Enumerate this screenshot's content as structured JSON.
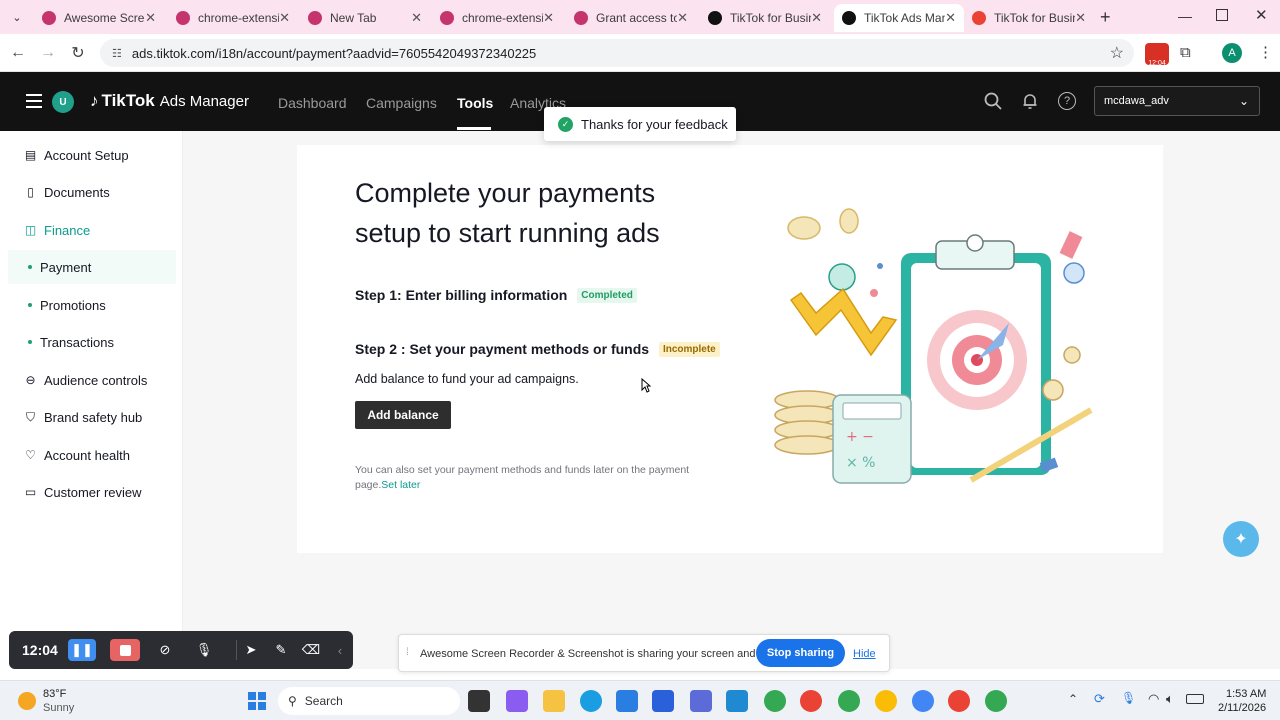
{
  "browser": {
    "tabs": [
      {
        "title": "Awesome Screen",
        "icon": "chrome-icon",
        "active": false
      },
      {
        "title": "chrome-extensio",
        "icon": "chrome-icon",
        "active": false
      },
      {
        "title": "New Tab",
        "icon": "chrome-icon",
        "active": false
      },
      {
        "title": "chrome-extensio",
        "icon": "chrome-icon",
        "active": false
      },
      {
        "title": "Grant access to f",
        "icon": "chrome-icon",
        "active": false
      },
      {
        "title": "TikTok for Busine",
        "icon": "tiktok-icon",
        "active": false
      },
      {
        "title": "TikTok Ads Mana",
        "icon": "tiktok-icon",
        "active": true
      },
      {
        "title": "TikTok for Busine",
        "icon": "gmail-icon",
        "active": false
      }
    ],
    "new_tab": "+",
    "url": "ads.tiktok.com/i18n/account/payment?aadvid=7605542049372340225",
    "ext_badge": "12:04",
    "profile_initial": "A"
  },
  "header": {
    "avatar_initial": "U",
    "brand": "TikTok",
    "brand_suffix": "Ads Manager",
    "nav": [
      "Dashboard",
      "Campaigns",
      "Tools",
      "Analytics"
    ],
    "active_nav": "Tools",
    "account": "mcdawa_adv"
  },
  "toast": {
    "text": "Thanks for your feedback"
  },
  "sidebar": {
    "items": [
      {
        "label": "Account Setup",
        "icon": "id-card-icon",
        "type": "top"
      },
      {
        "label": "Documents",
        "icon": "document-icon",
        "type": "top"
      },
      {
        "label": "Finance",
        "icon": "wallet-icon",
        "type": "top",
        "state": "active-parent"
      },
      {
        "label": "Payment",
        "type": "sub",
        "state": "active"
      },
      {
        "label": "Promotions",
        "type": "sub"
      },
      {
        "label": "Transactions",
        "type": "sub"
      },
      {
        "label": "Audience controls",
        "icon": "audience-icon",
        "type": "top"
      },
      {
        "label": "Brand safety hub",
        "icon": "shield-icon",
        "type": "top"
      },
      {
        "label": "Account health",
        "icon": "heart-icon",
        "type": "top"
      },
      {
        "label": "Customer review",
        "icon": "review-icon",
        "type": "top"
      }
    ]
  },
  "main": {
    "title_line1": "Complete your payments",
    "title_line2": "setup to start running ads",
    "step1": {
      "label": "Step 1: Enter billing information",
      "badge": "Completed"
    },
    "step2": {
      "label": "Step 2 : Set your payment methods or funds",
      "badge": "Incomplete"
    },
    "step2_desc": "Add balance to fund your ad campaigns.",
    "add_balance": "Add balance",
    "later_note": "You can also set your payment methods and funds later on the payment page.",
    "set_later": "Set later"
  },
  "recorder": {
    "time": "12:04"
  },
  "sharebar": {
    "text": "Awesome Screen Recorder & Screenshot is sharing your screen and audio.",
    "stop": "Stop sharing",
    "hide": "Hide"
  },
  "taskbar": {
    "weather_temp": "83°F",
    "weather_desc": "Sunny",
    "search": "Search",
    "time": "1:53 AM",
    "date": "2/11/2026"
  },
  "colors": {
    "accent": "#0b9c8f",
    "completed_bg": "#e6f7ef",
    "completed_fg": "#1f9d63",
    "incomplete_bg": "#fdf1c9",
    "incomplete_fg": "#9a6a00",
    "stop_sharing": "#1a73e8"
  }
}
